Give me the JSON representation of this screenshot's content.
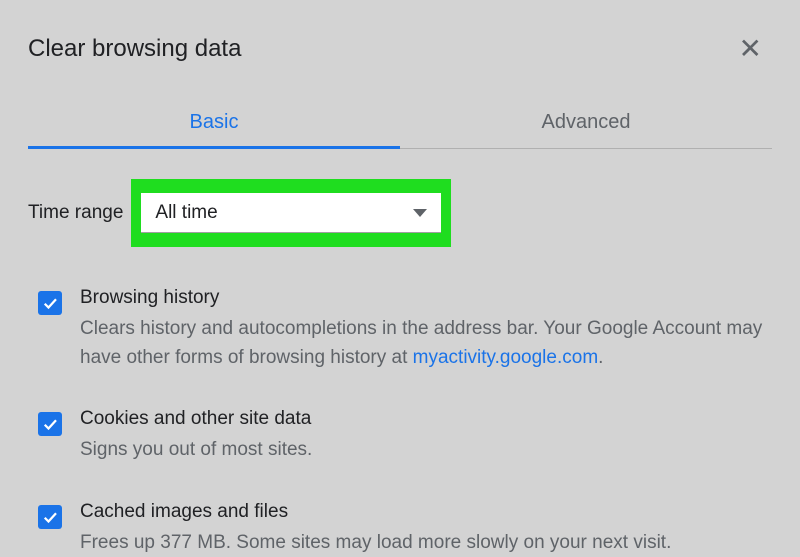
{
  "header": {
    "title": "Clear browsing data"
  },
  "tabs": {
    "basic": "Basic",
    "advanced": "Advanced"
  },
  "timeRange": {
    "label": "Time range",
    "value": "All time"
  },
  "items": [
    {
      "title": "Browsing history",
      "descPrefix": "Clears history and autocompletions in the address bar. Your Google Account may have other forms of browsing history at ",
      "link": "myactivity.google.com",
      "descSuffix": "."
    },
    {
      "title": "Cookies and other site data",
      "desc": "Signs you out of most sites."
    },
    {
      "title": "Cached images and files",
      "desc": "Frees up 377 MB. Some sites may load more slowly on your next visit."
    }
  ]
}
